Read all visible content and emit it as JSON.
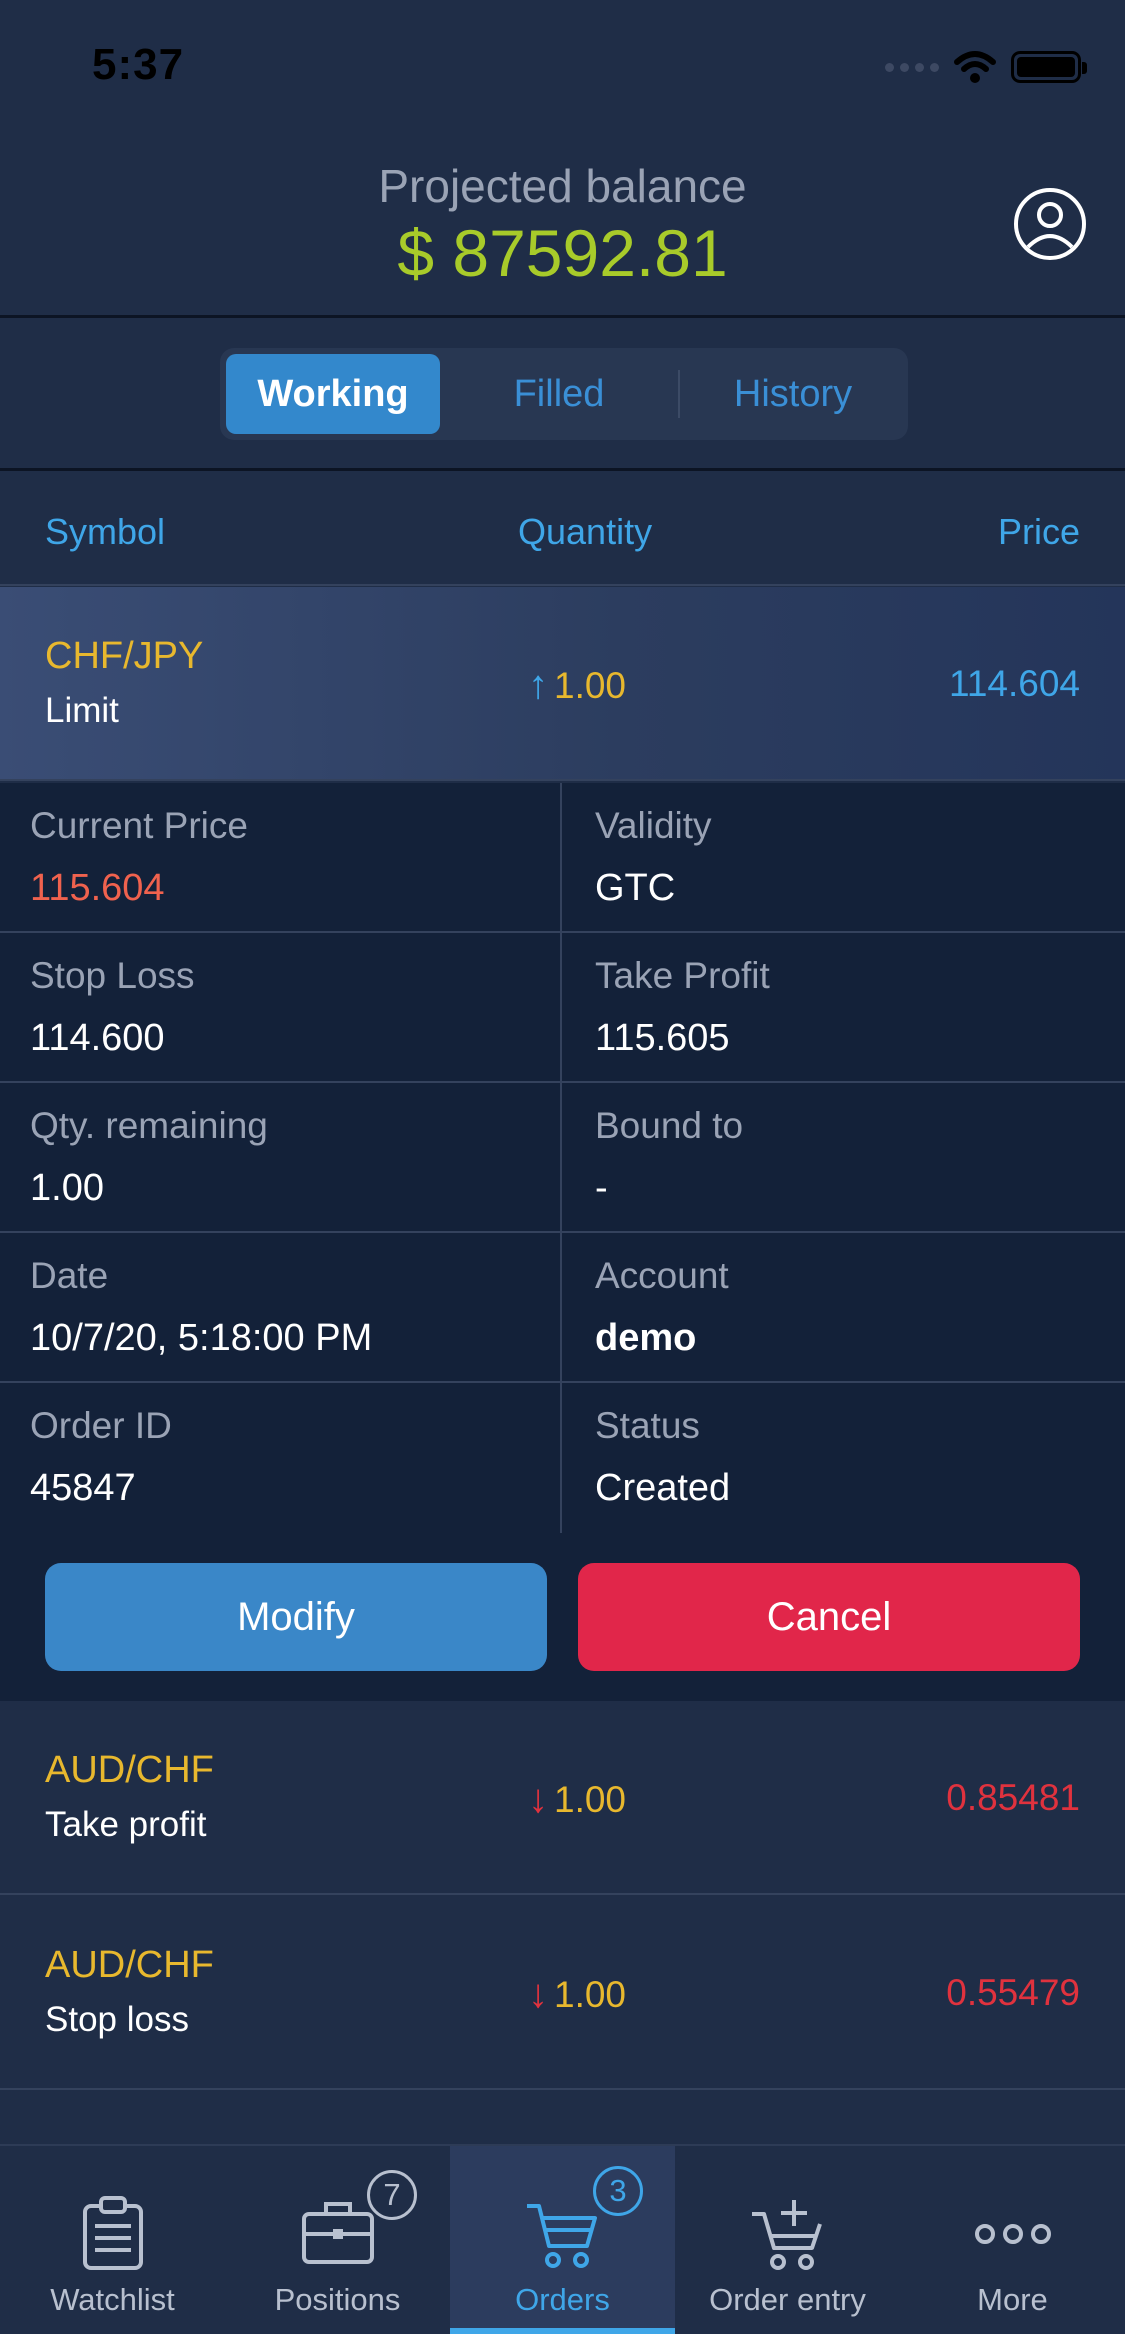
{
  "status_bar": {
    "time": "5:37"
  },
  "header": {
    "balance_label": "Projected balance",
    "balance_value": "$ 87592.81",
    "balance_color": "#a8cb2a"
  },
  "segments": {
    "working": "Working",
    "filled": "Filled",
    "history": "History",
    "selected": "Working"
  },
  "columns": {
    "symbol": "Symbol",
    "quantity": "Quantity",
    "price": "Price"
  },
  "orders": [
    {
      "symbol": "CHF/JPY",
      "type": "Limit",
      "direction": "up",
      "qty": "1.00",
      "price": "114.604",
      "price_color": "#3fa6e8",
      "selected": true
    },
    {
      "symbol": "AUD/CHF",
      "type": "Take profit",
      "direction": "down",
      "qty": "1.00",
      "price": "0.85481",
      "price_color": "#e0323e",
      "selected": false
    },
    {
      "symbol": "AUD/CHF",
      "type": "Stop loss",
      "direction": "down",
      "qty": "1.00",
      "price": "0.55479",
      "price_color": "#e0323e",
      "selected": false
    }
  ],
  "details": {
    "current_price_label": "Current Price",
    "current_price": "115.604",
    "current_price_color": "#f0624e",
    "validity_label": "Validity",
    "validity": "GTC",
    "stop_loss_label": "Stop Loss",
    "stop_loss": "114.600",
    "take_profit_label": "Take Profit",
    "take_profit": "115.605",
    "qty_remaining_label": "Qty. remaining",
    "qty_remaining": "1.00",
    "bound_to_label": "Bound to",
    "bound_to": "-",
    "date_label": "Date",
    "date": "10/7/20, 5:18:00 PM",
    "account_label": "Account",
    "account": "demo",
    "order_id_label": "Order ID",
    "order_id": "45847",
    "status_label": "Status",
    "status": "Created",
    "modify_label": "Modify",
    "cancel_label": "Cancel"
  },
  "tabbar": {
    "active": "Orders",
    "items": [
      {
        "label": "Watchlist",
        "icon": "clipboard-icon"
      },
      {
        "label": "Positions",
        "icon": "briefcase-icon",
        "badge": "7"
      },
      {
        "label": "Orders",
        "icon": "cart-icon",
        "badge": "3"
      },
      {
        "label": "Order entry",
        "icon": "cart-plus-icon"
      },
      {
        "label": "More",
        "icon": "more-dots-icon"
      }
    ]
  }
}
